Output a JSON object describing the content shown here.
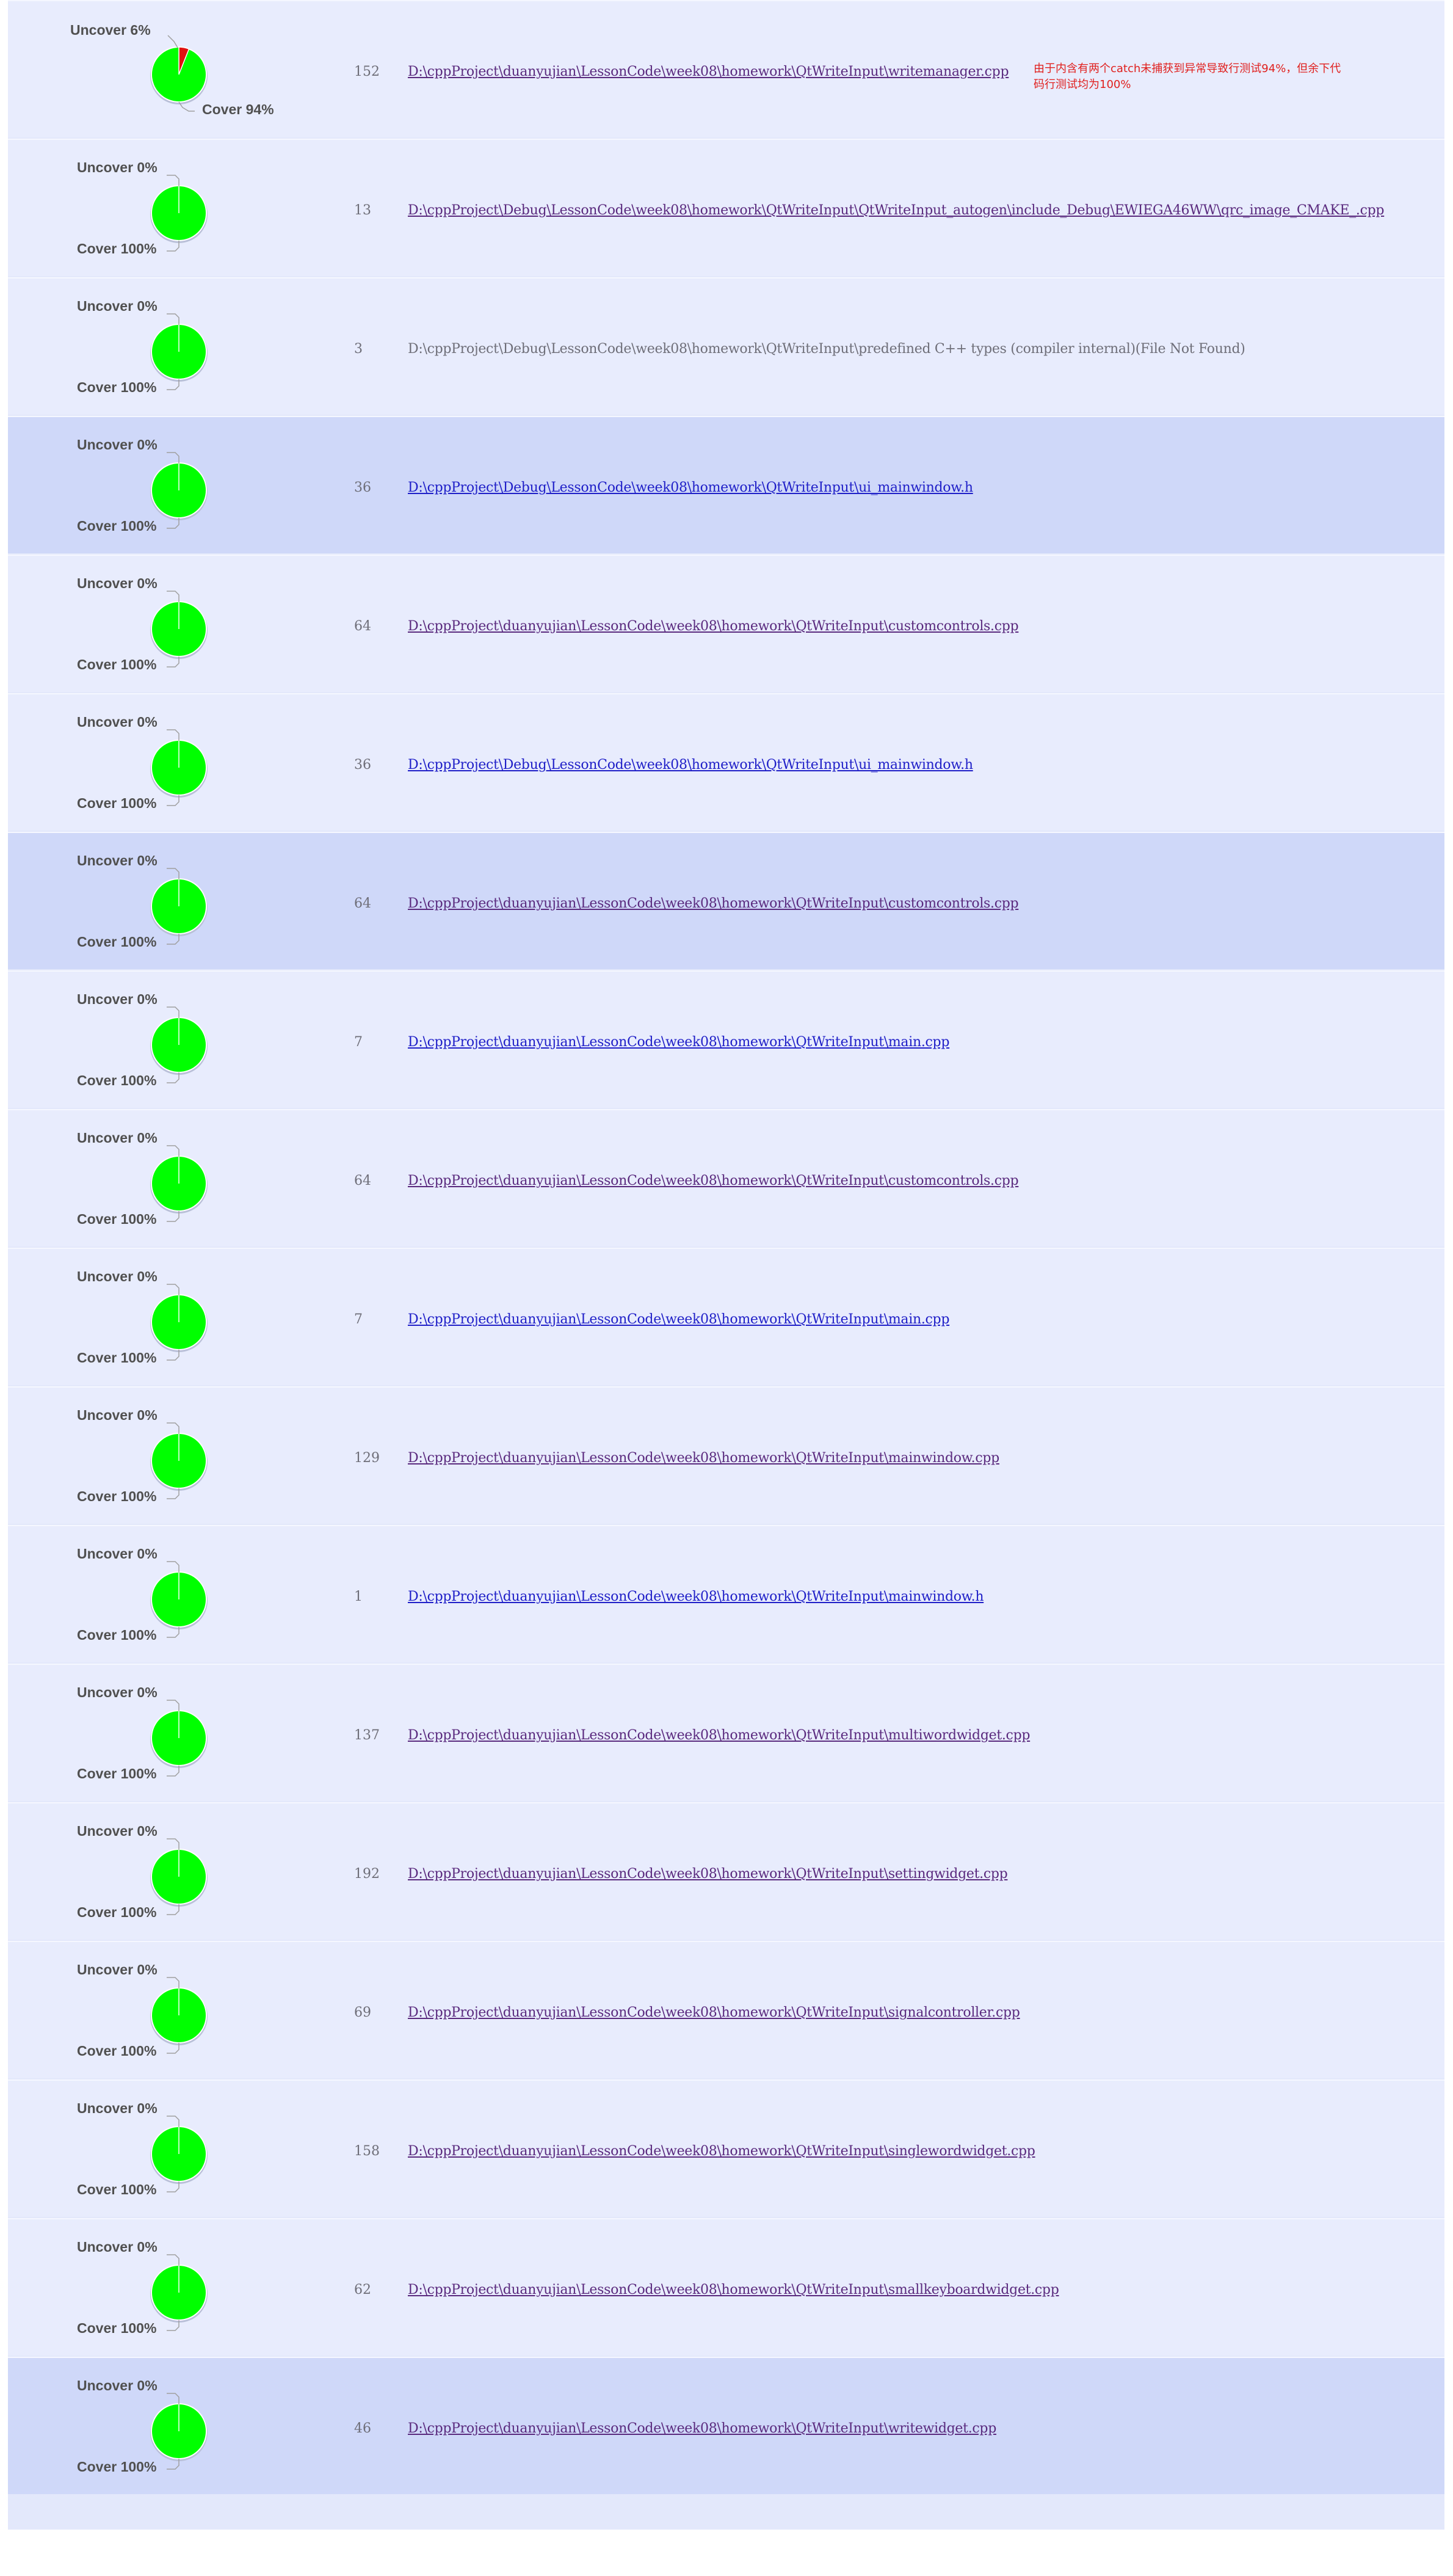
{
  "colors": {
    "cover": "#00ff00",
    "uncover": "#e01010",
    "visited_link": "#5a2a7e",
    "unvisited_link": "#2020c8"
  },
  "rows": [
    {
      "uncover_label": "Uncover 6%",
      "cover_label": "Cover 94%",
      "uncover_fraction": 0.06,
      "count": "152",
      "path": "D:\\cppProject\\duanyujian\\LessonCode\\week08\\homework\\QtWriteInput\\writemanager.cpp",
      "link": "visited",
      "note": "由于内含有两个catch未捕获到异常导致行测试94%，但余下代码行测试均为100%"
    },
    {
      "uncover_label": "Uncover 0%",
      "cover_label": "Cover 100%",
      "uncover_fraction": 0,
      "count": "13",
      "path": "D:\\cppProject\\Debug\\LessonCode\\week08\\homework\\QtWriteInput\\QtWriteInput_autogen\\include_Debug\\EWIEGA46WW\\qrc_image_CMAKE_.cpp",
      "link": "visited"
    },
    {
      "uncover_label": "Uncover 0%",
      "cover_label": "Cover 100%",
      "uncover_fraction": 0,
      "count": "3",
      "path": "D:\\cppProject\\Debug\\LessonCode\\week08\\homework\\QtWriteInput\\predefined C++ types (compiler internal)(File Not Found)",
      "link": "none"
    },
    {
      "uncover_label": "Uncover 0%",
      "cover_label": "Cover 100%",
      "uncover_fraction": 0,
      "count": "36",
      "path": "D:\\cppProject\\Debug\\LessonCode\\week08\\homework\\QtWriteInput\\ui_mainwindow.h",
      "link": "unvisited",
      "highlight": true
    },
    {
      "uncover_label": "Uncover 0%",
      "cover_label": "Cover 100%",
      "uncover_fraction": 0,
      "count": "64",
      "path": "D:\\cppProject\\duanyujian\\LessonCode\\week08\\homework\\QtWriteInput\\customcontrols.cpp",
      "link": "visited"
    },
    {
      "uncover_label": "Uncover 0%",
      "cover_label": "Cover 100%",
      "uncover_fraction": 0,
      "count": "36",
      "path": "D:\\cppProject\\Debug\\LessonCode\\week08\\homework\\QtWriteInput\\ui_mainwindow.h",
      "link": "unvisited"
    },
    {
      "uncover_label": "Uncover 0%",
      "cover_label": "Cover 100%",
      "uncover_fraction": 0,
      "count": "64",
      "path": "D:\\cppProject\\duanyujian\\LessonCode\\week08\\homework\\QtWriteInput\\customcontrols.cpp",
      "link": "visited",
      "highlight": true
    },
    {
      "uncover_label": "Uncover 0%",
      "cover_label": "Cover 100%",
      "uncover_fraction": 0,
      "count": "7",
      "path": "D:\\cppProject\\duanyujian\\LessonCode\\week08\\homework\\QtWriteInput\\main.cpp",
      "link": "unvisited"
    },
    {
      "uncover_label": "Uncover 0%",
      "cover_label": "Cover 100%",
      "uncover_fraction": 0,
      "count": "64",
      "path": "D:\\cppProject\\duanyujian\\LessonCode\\week08\\homework\\QtWriteInput\\customcontrols.cpp",
      "link": "visited"
    },
    {
      "uncover_label": "Uncover 0%",
      "cover_label": "Cover 100%",
      "uncover_fraction": 0,
      "count": "7",
      "path": "D:\\cppProject\\duanyujian\\LessonCode\\week08\\homework\\QtWriteInput\\main.cpp",
      "link": "unvisited"
    },
    {
      "uncover_label": "Uncover 0%",
      "cover_label": "Cover 100%",
      "uncover_fraction": 0,
      "count": "129",
      "path": "D:\\cppProject\\duanyujian\\LessonCode\\week08\\homework\\QtWriteInput\\mainwindow.cpp",
      "link": "visited"
    },
    {
      "uncover_label": "Uncover 0%",
      "cover_label": "Cover 100%",
      "uncover_fraction": 0,
      "count": "1",
      "path": "D:\\cppProject\\duanyujian\\LessonCode\\week08\\homework\\QtWriteInput\\mainwindow.h",
      "link": "unvisited"
    },
    {
      "uncover_label": "Uncover 0%",
      "cover_label": "Cover 100%",
      "uncover_fraction": 0,
      "count": "137",
      "path": "D:\\cppProject\\duanyujian\\LessonCode\\week08\\homework\\QtWriteInput\\multiwordwidget.cpp",
      "link": "visited"
    },
    {
      "uncover_label": "Uncover 0%",
      "cover_label": "Cover 100%",
      "uncover_fraction": 0,
      "count": "192",
      "path": "D:\\cppProject\\duanyujian\\LessonCode\\week08\\homework\\QtWriteInput\\settingwidget.cpp",
      "link": "visited"
    },
    {
      "uncover_label": "Uncover 0%",
      "cover_label": "Cover 100%",
      "uncover_fraction": 0,
      "count": "69",
      "path": "D:\\cppProject\\duanyujian\\LessonCode\\week08\\homework\\QtWriteInput\\signalcontroller.cpp",
      "link": "visited"
    },
    {
      "uncover_label": "Uncover 0%",
      "cover_label": "Cover 100%",
      "uncover_fraction": 0,
      "count": "158",
      "path": "D:\\cppProject\\duanyujian\\LessonCode\\week08\\homework\\QtWriteInput\\singlewordwidget.cpp",
      "link": "visited"
    },
    {
      "uncover_label": "Uncover 0%",
      "cover_label": "Cover 100%",
      "uncover_fraction": 0,
      "count": "62",
      "path": "D:\\cppProject\\duanyujian\\LessonCode\\week08\\homework\\QtWriteInput\\smallkeyboardwidget.cpp",
      "link": "visited"
    },
    {
      "uncover_label": "Uncover 0%",
      "cover_label": "Cover 100%",
      "uncover_fraction": 0,
      "count": "46",
      "path": "D:\\cppProject\\duanyujian\\LessonCode\\week08\\homework\\QtWriteInput\\writewidget.cpp",
      "link": "visited",
      "highlight": true
    }
  ]
}
